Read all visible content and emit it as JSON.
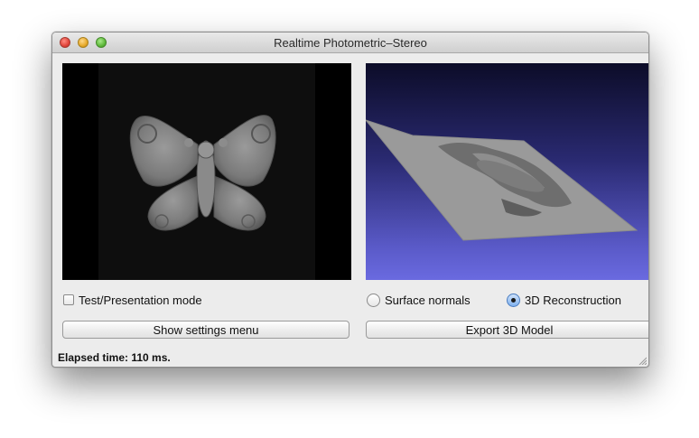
{
  "window": {
    "title": "Realtime Photometric–Stereo"
  },
  "left_view": {
    "test_mode_label": "Test/Presentation mode",
    "test_mode_checked": false
  },
  "right_view": {
    "radio_normals_label": "Surface normals",
    "radio_reconstruction_label": "3D Reconstruction",
    "selected": "3D Reconstruction"
  },
  "buttons": {
    "settings_label": "Show settings menu",
    "export_label": "Export 3D Model"
  },
  "status": {
    "elapsed_text": "Elapsed time: 110 ms."
  }
}
